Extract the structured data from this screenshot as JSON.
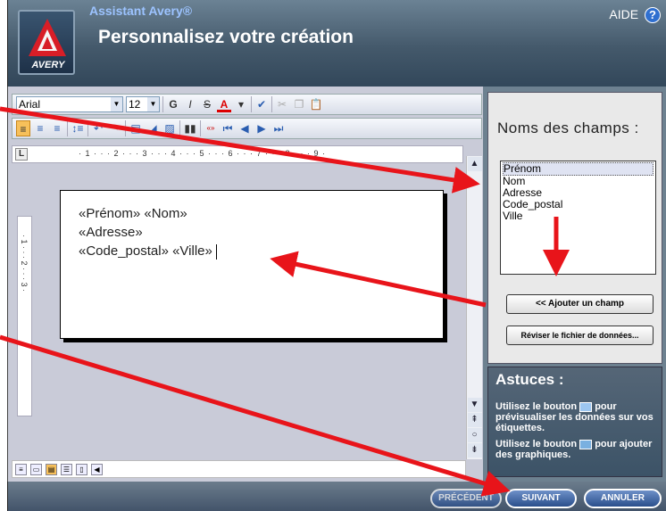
{
  "header": {
    "assistant": "Assistant Avery®",
    "title": "Personnalisez votre création",
    "help": "AIDE",
    "help_icon": "?",
    "logo_text": "AVERY"
  },
  "toolbar": {
    "font": "Arial",
    "size": "12",
    "bold": "G",
    "italic": "I",
    "strike": "S",
    "font_color": "A",
    "row2_icons": [
      "align-left-icon",
      "align-center-icon",
      "align-right-icon",
      "line-spacing-icon",
      "undo-icon",
      "redo-icon",
      "text-box-icon",
      "paint-icon",
      "image-icon",
      "barcode-icon",
      "merge-field-icon",
      "first-record-icon",
      "prev-record-icon",
      "next-record-icon",
      "last-record-icon"
    ]
  },
  "ruler": {
    "corner": "L",
    "scale": "· 1 · · · 2 · · · 3 · · · 4 · · · 5 · · · 6 · · · 7 · · · 8 · · · 9 ·",
    "vertical": "· 1 · · · 2 · · · 3 ·"
  },
  "document": {
    "lines": [
      "«Prénom» «Nom»",
      "«Adresse»",
      "«Code_postal»  «Ville»"
    ]
  },
  "side": {
    "fields_title": "Noms des champs :",
    "fields": [
      "Prénom",
      "Nom",
      "Adresse",
      "Code_postal",
      "Ville"
    ],
    "selected_field": "Prénom",
    "add_field_button": "<< Ajouter un champ",
    "review_button": "Réviser le fichier de données...",
    "tips_title": "Astuces :",
    "tip1_a": "Utilisez le bouton",
    "tip1_b": "pour prévisualiser les données sur vos étiquettes.",
    "tip2_a": "Utilisez le bouton",
    "tip2_b": "pour ajouter des graphiques."
  },
  "footer": {
    "previous": "PRÉCÉDENT",
    "next": "SUIVANT",
    "cancel": "ANNULER"
  },
  "colors": {
    "header_bg": "#44596b",
    "side_bg": "#6d8190",
    "annotation_arrow": "#e8141a",
    "nav_button": "#2a4f8c"
  }
}
